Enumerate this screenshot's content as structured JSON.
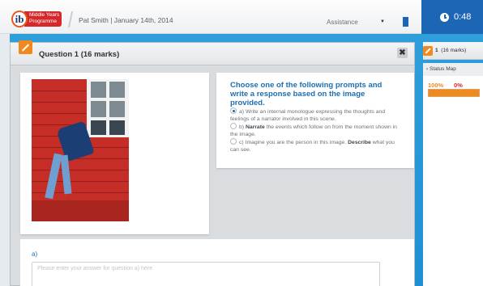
{
  "header": {
    "logo_mark": "ib",
    "logo_line1": "Middle Years",
    "logo_line2": "Programme",
    "user_info": "Pat Smith  |  January 14th, 2014",
    "assistance_label": "Assistance",
    "bookmark_icon": "bookmark-icon",
    "timer": "0:48"
  },
  "question": {
    "title": "Question 1 (16 marks)",
    "close_label": "✖",
    "prompt_title": "Choose one of the following prompts and write a response based on the image provided.",
    "options": [
      {
        "prefix": "a) ",
        "bold": "",
        "text": "Write an internal monologue expressing the thoughts and feelings of a narrator involved in this scene.",
        "selected": true
      },
      {
        "prefix": "b) ",
        "bold": "Narrate",
        "text": " the events which follow on from the moment shown in the image.",
        "selected": false
      },
      {
        "prefix": "c) Imagine you are the person in this image. ",
        "bold": "Describe",
        "text": " what you can see.",
        "selected": false
      }
    ],
    "answer_label": "a)",
    "answer_placeholder": "Please enter your answer for question a) here",
    "answer_value": ""
  },
  "sidebar": {
    "question_number": "1",
    "question_marks": "(16 marks)",
    "status_map_label": "Status Map",
    "progress_label": "100%",
    "other_label": "0%",
    "progress_fraction": 1.0
  },
  "colors": {
    "accent_blue": "#1c66b5",
    "orange": "#f08a1c",
    "brand_red": "#d6282b"
  }
}
